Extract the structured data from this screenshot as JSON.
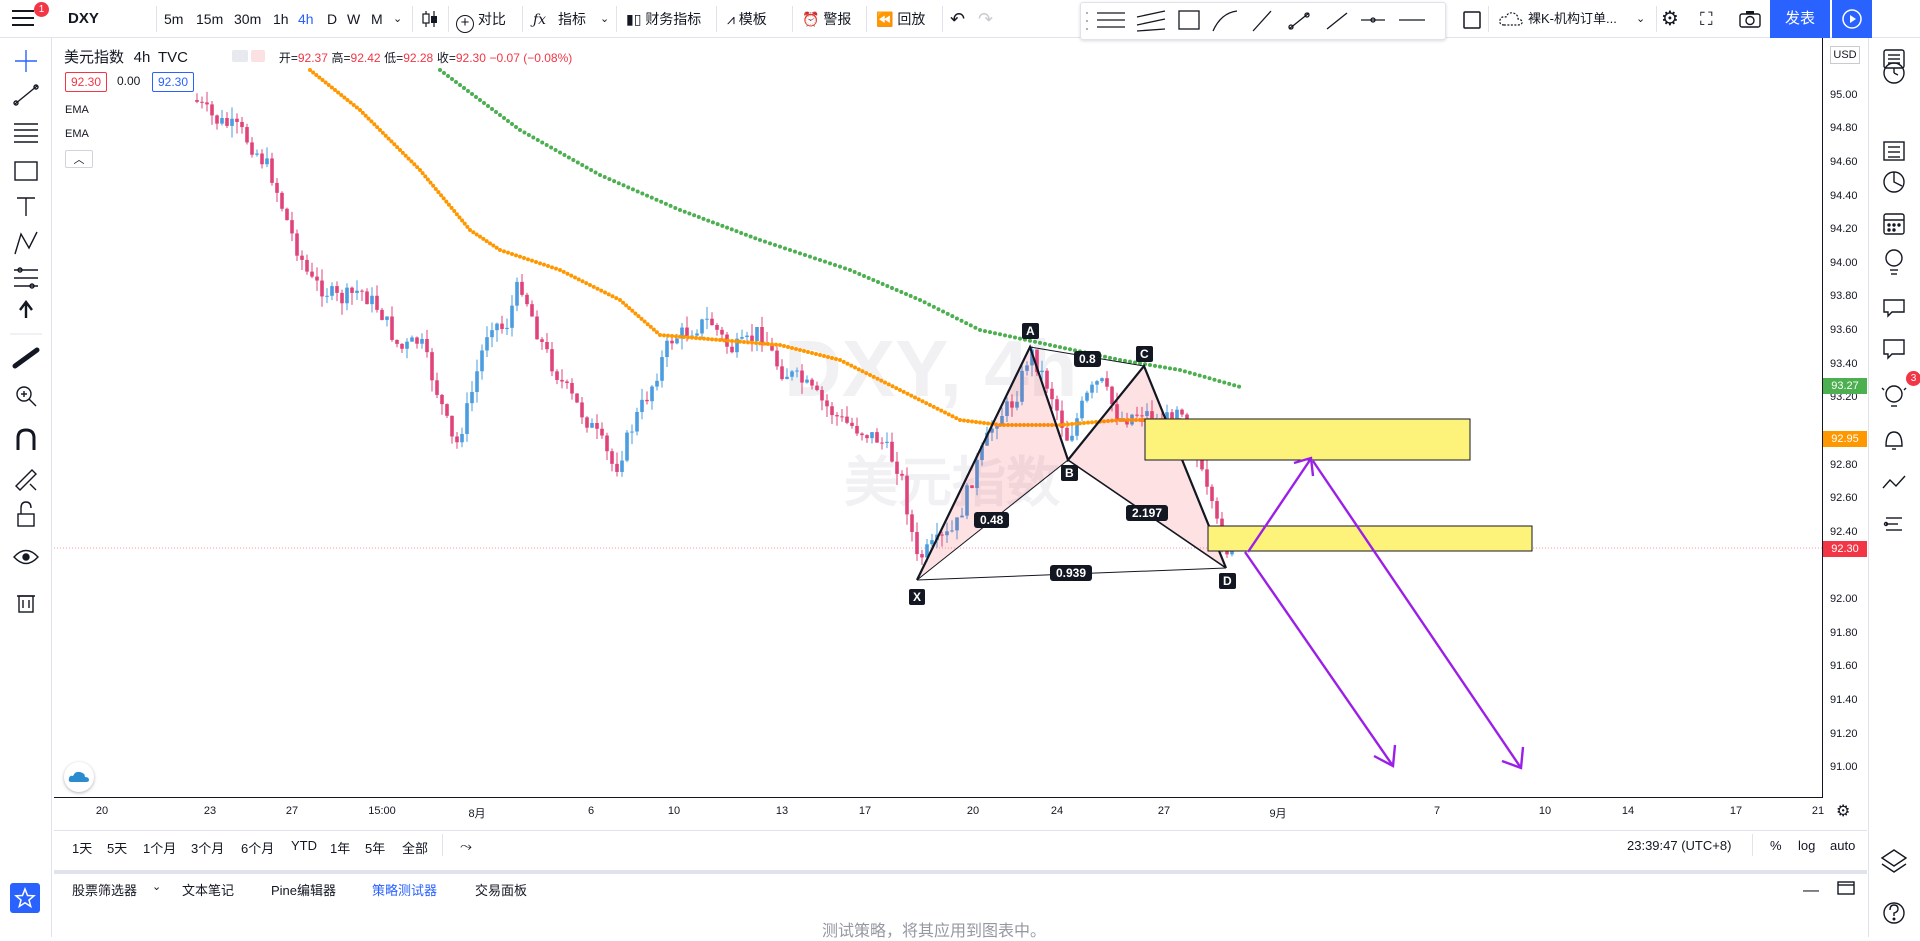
{
  "topbar": {
    "menu_badge": "1",
    "symbol": "DXY",
    "intervals": [
      "5m",
      "15m",
      "30m",
      "1h",
      "4h",
      "D",
      "W",
      "M"
    ],
    "active_interval": "4h",
    "compare": "对比",
    "indicators": "指标",
    "financials": "财务指标",
    "templates": "模板",
    "alert": "警报",
    "replay": "回放",
    "layout_name": "裸K-机构订单...",
    "publish": "发表"
  },
  "legend": {
    "name": "美元指数",
    "interval": "4h",
    "source": "TVC",
    "open_label": "开=",
    "open": "92.37",
    "high_label": "高=",
    "high": "92.42",
    "low_label": "低=",
    "low": "92.28",
    "close_label": "收=",
    "close": "92.30",
    "change": "−0.07 (−0.08%)",
    "bid": "92.30",
    "spread": "0.00",
    "ask": "92.30",
    "indicator1": "EMA",
    "indicator2": "EMA"
  },
  "watermark": {
    "symbol": "DXY, 4h",
    "name": "美元指数"
  },
  "price_axis": {
    "currency": "USD",
    "labels": [
      "95.00",
      "94.80",
      "94.60",
      "94.40",
      "94.20",
      "94.00",
      "93.80",
      "93.60",
      "93.40",
      "93.20",
      "92.80",
      "92.60",
      "92.40",
      "92.00",
      "91.80",
      "91.60",
      "91.40",
      "91.20",
      "91.00"
    ],
    "tag_green": "93.27",
    "tag_orange": "92.95",
    "tag_red": "92.30"
  },
  "time_axis": {
    "labels": [
      "20",
      "23",
      "27",
      "15:00",
      "8月",
      "6",
      "10",
      "13",
      "17",
      "20",
      "24",
      "27",
      "9月",
      "7",
      "10",
      "14",
      "17",
      "21"
    ]
  },
  "pattern": {
    "points": [
      "X",
      "A",
      "B",
      "C",
      "D"
    ],
    "ratios": [
      "0.8",
      "0.48",
      "2.197",
      "0.939"
    ]
  },
  "rangebar": {
    "ranges": [
      "1天",
      "5天",
      "1个月",
      "3个月",
      "6个月",
      "YTD",
      "1年",
      "5年",
      "全部"
    ],
    "clock": "23:39:47 (UTC+8)",
    "percent": "%",
    "log": "log",
    "auto": "auto"
  },
  "bottom": {
    "tabs": [
      "股票筛选器",
      "文本笔记",
      "Pine编辑器",
      "策略测试器",
      "交易面板"
    ],
    "active_tab": "策略测试器",
    "message": "测试策略，将其应用到图表中。"
  },
  "right_badge": "3"
}
